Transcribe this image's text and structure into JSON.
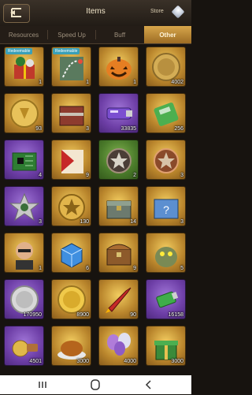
{
  "header": {
    "title": "Items",
    "store_label": "Store"
  },
  "tabs": [
    {
      "label": "Resources",
      "active": false
    },
    {
      "label": "Speed Up",
      "active": false
    },
    {
      "label": "Buff",
      "active": false
    },
    {
      "label": "Other",
      "active": true
    }
  ],
  "badge_label": "Redeemable",
  "items": [
    {
      "icon": "holiday-pack-icon",
      "rarity": "gold",
      "count": "1",
      "badge": true
    },
    {
      "icon": "route-map-icon",
      "rarity": "gold",
      "count": "1",
      "badge": true
    },
    {
      "icon": "pumpkin-icon",
      "rarity": "gold",
      "count": "1",
      "badge": false
    },
    {
      "icon": "gold-token-icon",
      "rarity": "gold",
      "count": "4002",
      "badge": false
    },
    {
      "icon": "gold-medal-coin-icon",
      "rarity": "gold",
      "count": "93",
      "badge": false
    },
    {
      "icon": "supply-crate-icon",
      "rarity": "gold",
      "count": "3",
      "badge": false
    },
    {
      "icon": "purple-chip-icon",
      "rarity": "purple",
      "count": "33835",
      "badge": false
    },
    {
      "icon": "green-battery-icon",
      "rarity": "gold",
      "count": "256",
      "badge": false
    },
    {
      "icon": "green-circuit-board-icon",
      "rarity": "purple",
      "count": "4",
      "badge": false
    },
    {
      "icon": "red-manual-icon",
      "rarity": "gold",
      "count": "9",
      "badge": false
    },
    {
      "icon": "star-medal-icon",
      "rarity": "green",
      "count": "2",
      "badge": false
    },
    {
      "icon": "bronze-star-medal-icon",
      "rarity": "gold",
      "count": "3",
      "badge": false
    },
    {
      "icon": "silver-star-badge-icon",
      "rarity": "purple",
      "count": "3",
      "badge": false
    },
    {
      "icon": "gold-star-badge-icon",
      "rarity": "gold",
      "count": "130",
      "badge": false
    },
    {
      "icon": "green-chest-icon",
      "rarity": "gold",
      "count": "14",
      "badge": false
    },
    {
      "icon": "mystery-box-icon",
      "rarity": "gold",
      "count": "3",
      "badge": false
    },
    {
      "icon": "commander-avatar-icon",
      "rarity": "gold",
      "count": "1",
      "badge": false
    },
    {
      "icon": "blue-cube-icon",
      "rarity": "gold",
      "count": "6",
      "badge": false
    },
    {
      "icon": "treasure-chest-icon",
      "rarity": "gold",
      "count": "9",
      "badge": false
    },
    {
      "icon": "monster-figure-icon",
      "rarity": "gold",
      "count": "5",
      "badge": false
    },
    {
      "icon": "silver-coin-icon",
      "rarity": "purple",
      "count": "170950",
      "badge": false
    },
    {
      "icon": "gold-coin-icon",
      "rarity": "gold",
      "count": "8900",
      "badge": false
    },
    {
      "icon": "red-rocket-icon",
      "rarity": "gold",
      "count": "90",
      "badge": false
    },
    {
      "icon": "green-usb-icon",
      "rarity": "purple",
      "count": "16158",
      "badge": false
    },
    {
      "icon": "gold-reel-usb-icon",
      "rarity": "purple",
      "count": "4501",
      "badge": false
    },
    {
      "icon": "roast-turkey-icon",
      "rarity": "gold",
      "count": "3000",
      "badge": false
    },
    {
      "icon": "balloons-icon",
      "rarity": "gold",
      "count": "4000",
      "badge": false
    },
    {
      "icon": "gift-box-icon",
      "rarity": "gold",
      "count": "3000",
      "badge": false
    }
  ],
  "navbar": {
    "recents": "recents-icon",
    "home": "home-icon",
    "back": "back-icon"
  }
}
